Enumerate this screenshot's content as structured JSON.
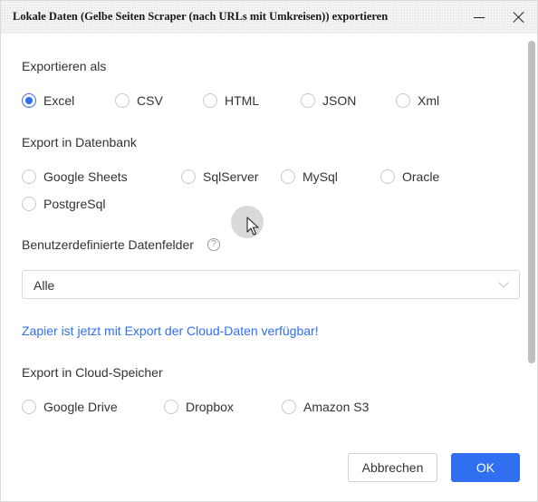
{
  "window": {
    "title": "Lokale Daten (Gelbe Seiten Scraper (nach URLs mit Umkreisen)) exportieren",
    "minimize_icon": "minimize-icon",
    "close_icon": "close-icon"
  },
  "export_as": {
    "title": "Exportieren als",
    "options": [
      {
        "label": "Excel",
        "checked": true
      },
      {
        "label": "CSV",
        "checked": false
      },
      {
        "label": "HTML",
        "checked": false
      },
      {
        "label": "JSON",
        "checked": false
      },
      {
        "label": "Xml",
        "checked": false
      }
    ]
  },
  "database": {
    "title": "Export in Datenbank",
    "options": [
      {
        "label": "Google Sheets"
      },
      {
        "label": "SqlServer"
      },
      {
        "label": "MySql"
      },
      {
        "label": "Oracle"
      },
      {
        "label": "PostgreSql"
      }
    ]
  },
  "custom_fields": {
    "title": "Benutzerdefinierte Datenfelder",
    "help_icon": "question-circle-icon",
    "help_glyph": "?",
    "selected": "Alle"
  },
  "zapier_link": "Zapier ist jetzt mit Export der Cloud-Daten verfügbar!",
  "cloud": {
    "title": "Export in Cloud-Speicher",
    "options": [
      {
        "label": "Google Drive"
      },
      {
        "label": "Dropbox"
      },
      {
        "label": "Amazon S3"
      }
    ]
  },
  "buttons": {
    "cancel": "Abbrechen",
    "ok": "OK"
  },
  "colors": {
    "accent": "#2f6ff0",
    "text": "#333333",
    "border": "#d9d9d9"
  }
}
